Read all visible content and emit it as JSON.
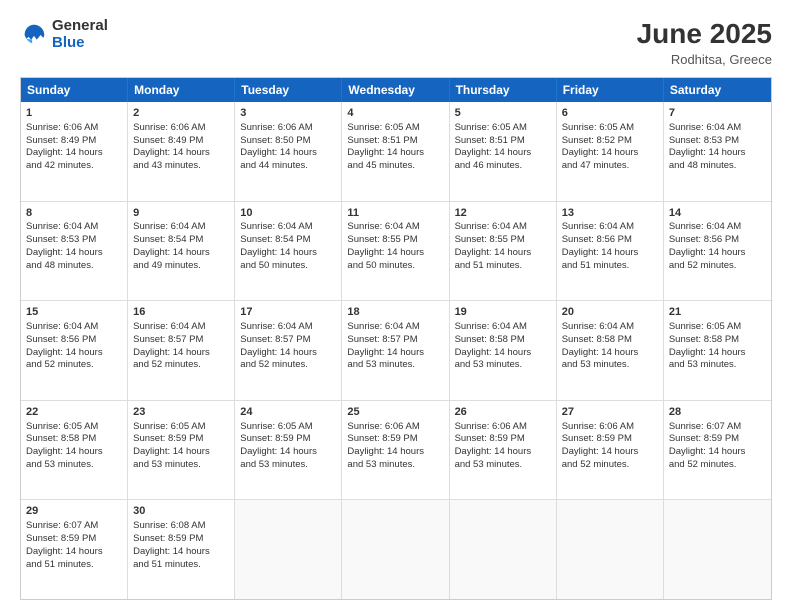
{
  "logo": {
    "general": "General",
    "blue": "Blue"
  },
  "title": "June 2025",
  "subtitle": "Rodhitsa, Greece",
  "header_days": [
    "Sunday",
    "Monday",
    "Tuesday",
    "Wednesday",
    "Thursday",
    "Friday",
    "Saturday"
  ],
  "rows": [
    [
      {
        "day": "1",
        "lines": [
          "Sunrise: 6:06 AM",
          "Sunset: 8:49 PM",
          "Daylight: 14 hours",
          "and 42 minutes."
        ]
      },
      {
        "day": "2",
        "lines": [
          "Sunrise: 6:06 AM",
          "Sunset: 8:49 PM",
          "Daylight: 14 hours",
          "and 43 minutes."
        ]
      },
      {
        "day": "3",
        "lines": [
          "Sunrise: 6:06 AM",
          "Sunset: 8:50 PM",
          "Daylight: 14 hours",
          "and 44 minutes."
        ]
      },
      {
        "day": "4",
        "lines": [
          "Sunrise: 6:05 AM",
          "Sunset: 8:51 PM",
          "Daylight: 14 hours",
          "and 45 minutes."
        ]
      },
      {
        "day": "5",
        "lines": [
          "Sunrise: 6:05 AM",
          "Sunset: 8:51 PM",
          "Daylight: 14 hours",
          "and 46 minutes."
        ]
      },
      {
        "day": "6",
        "lines": [
          "Sunrise: 6:05 AM",
          "Sunset: 8:52 PM",
          "Daylight: 14 hours",
          "and 47 minutes."
        ]
      },
      {
        "day": "7",
        "lines": [
          "Sunrise: 6:04 AM",
          "Sunset: 8:53 PM",
          "Daylight: 14 hours",
          "and 48 minutes."
        ]
      }
    ],
    [
      {
        "day": "8",
        "lines": [
          "Sunrise: 6:04 AM",
          "Sunset: 8:53 PM",
          "Daylight: 14 hours",
          "and 48 minutes."
        ]
      },
      {
        "day": "9",
        "lines": [
          "Sunrise: 6:04 AM",
          "Sunset: 8:54 PM",
          "Daylight: 14 hours",
          "and 49 minutes."
        ]
      },
      {
        "day": "10",
        "lines": [
          "Sunrise: 6:04 AM",
          "Sunset: 8:54 PM",
          "Daylight: 14 hours",
          "and 50 minutes."
        ]
      },
      {
        "day": "11",
        "lines": [
          "Sunrise: 6:04 AM",
          "Sunset: 8:55 PM",
          "Daylight: 14 hours",
          "and 50 minutes."
        ]
      },
      {
        "day": "12",
        "lines": [
          "Sunrise: 6:04 AM",
          "Sunset: 8:55 PM",
          "Daylight: 14 hours",
          "and 51 minutes."
        ]
      },
      {
        "day": "13",
        "lines": [
          "Sunrise: 6:04 AM",
          "Sunset: 8:56 PM",
          "Daylight: 14 hours",
          "and 51 minutes."
        ]
      },
      {
        "day": "14",
        "lines": [
          "Sunrise: 6:04 AM",
          "Sunset: 8:56 PM",
          "Daylight: 14 hours",
          "and 52 minutes."
        ]
      }
    ],
    [
      {
        "day": "15",
        "lines": [
          "Sunrise: 6:04 AM",
          "Sunset: 8:56 PM",
          "Daylight: 14 hours",
          "and 52 minutes."
        ]
      },
      {
        "day": "16",
        "lines": [
          "Sunrise: 6:04 AM",
          "Sunset: 8:57 PM",
          "Daylight: 14 hours",
          "and 52 minutes."
        ]
      },
      {
        "day": "17",
        "lines": [
          "Sunrise: 6:04 AM",
          "Sunset: 8:57 PM",
          "Daylight: 14 hours",
          "and 52 minutes."
        ]
      },
      {
        "day": "18",
        "lines": [
          "Sunrise: 6:04 AM",
          "Sunset: 8:57 PM",
          "Daylight: 14 hours",
          "and 53 minutes."
        ]
      },
      {
        "day": "19",
        "lines": [
          "Sunrise: 6:04 AM",
          "Sunset: 8:58 PM",
          "Daylight: 14 hours",
          "and 53 minutes."
        ]
      },
      {
        "day": "20",
        "lines": [
          "Sunrise: 6:04 AM",
          "Sunset: 8:58 PM",
          "Daylight: 14 hours",
          "and 53 minutes."
        ]
      },
      {
        "day": "21",
        "lines": [
          "Sunrise: 6:05 AM",
          "Sunset: 8:58 PM",
          "Daylight: 14 hours",
          "and 53 minutes."
        ]
      }
    ],
    [
      {
        "day": "22",
        "lines": [
          "Sunrise: 6:05 AM",
          "Sunset: 8:58 PM",
          "Daylight: 14 hours",
          "and 53 minutes."
        ]
      },
      {
        "day": "23",
        "lines": [
          "Sunrise: 6:05 AM",
          "Sunset: 8:59 PM",
          "Daylight: 14 hours",
          "and 53 minutes."
        ]
      },
      {
        "day": "24",
        "lines": [
          "Sunrise: 6:05 AM",
          "Sunset: 8:59 PM",
          "Daylight: 14 hours",
          "and 53 minutes."
        ]
      },
      {
        "day": "25",
        "lines": [
          "Sunrise: 6:06 AM",
          "Sunset: 8:59 PM",
          "Daylight: 14 hours",
          "and 53 minutes."
        ]
      },
      {
        "day": "26",
        "lines": [
          "Sunrise: 6:06 AM",
          "Sunset: 8:59 PM",
          "Daylight: 14 hours",
          "and 53 minutes."
        ]
      },
      {
        "day": "27",
        "lines": [
          "Sunrise: 6:06 AM",
          "Sunset: 8:59 PM",
          "Daylight: 14 hours",
          "and 52 minutes."
        ]
      },
      {
        "day": "28",
        "lines": [
          "Sunrise: 6:07 AM",
          "Sunset: 8:59 PM",
          "Daylight: 14 hours",
          "and 52 minutes."
        ]
      }
    ],
    [
      {
        "day": "29",
        "lines": [
          "Sunrise: 6:07 AM",
          "Sunset: 8:59 PM",
          "Daylight: 14 hours",
          "and 51 minutes."
        ]
      },
      {
        "day": "30",
        "lines": [
          "Sunrise: 6:08 AM",
          "Sunset: 8:59 PM",
          "Daylight: 14 hours",
          "and 51 minutes."
        ]
      },
      {
        "day": "",
        "lines": []
      },
      {
        "day": "",
        "lines": []
      },
      {
        "day": "",
        "lines": []
      },
      {
        "day": "",
        "lines": []
      },
      {
        "day": "",
        "lines": []
      }
    ]
  ]
}
